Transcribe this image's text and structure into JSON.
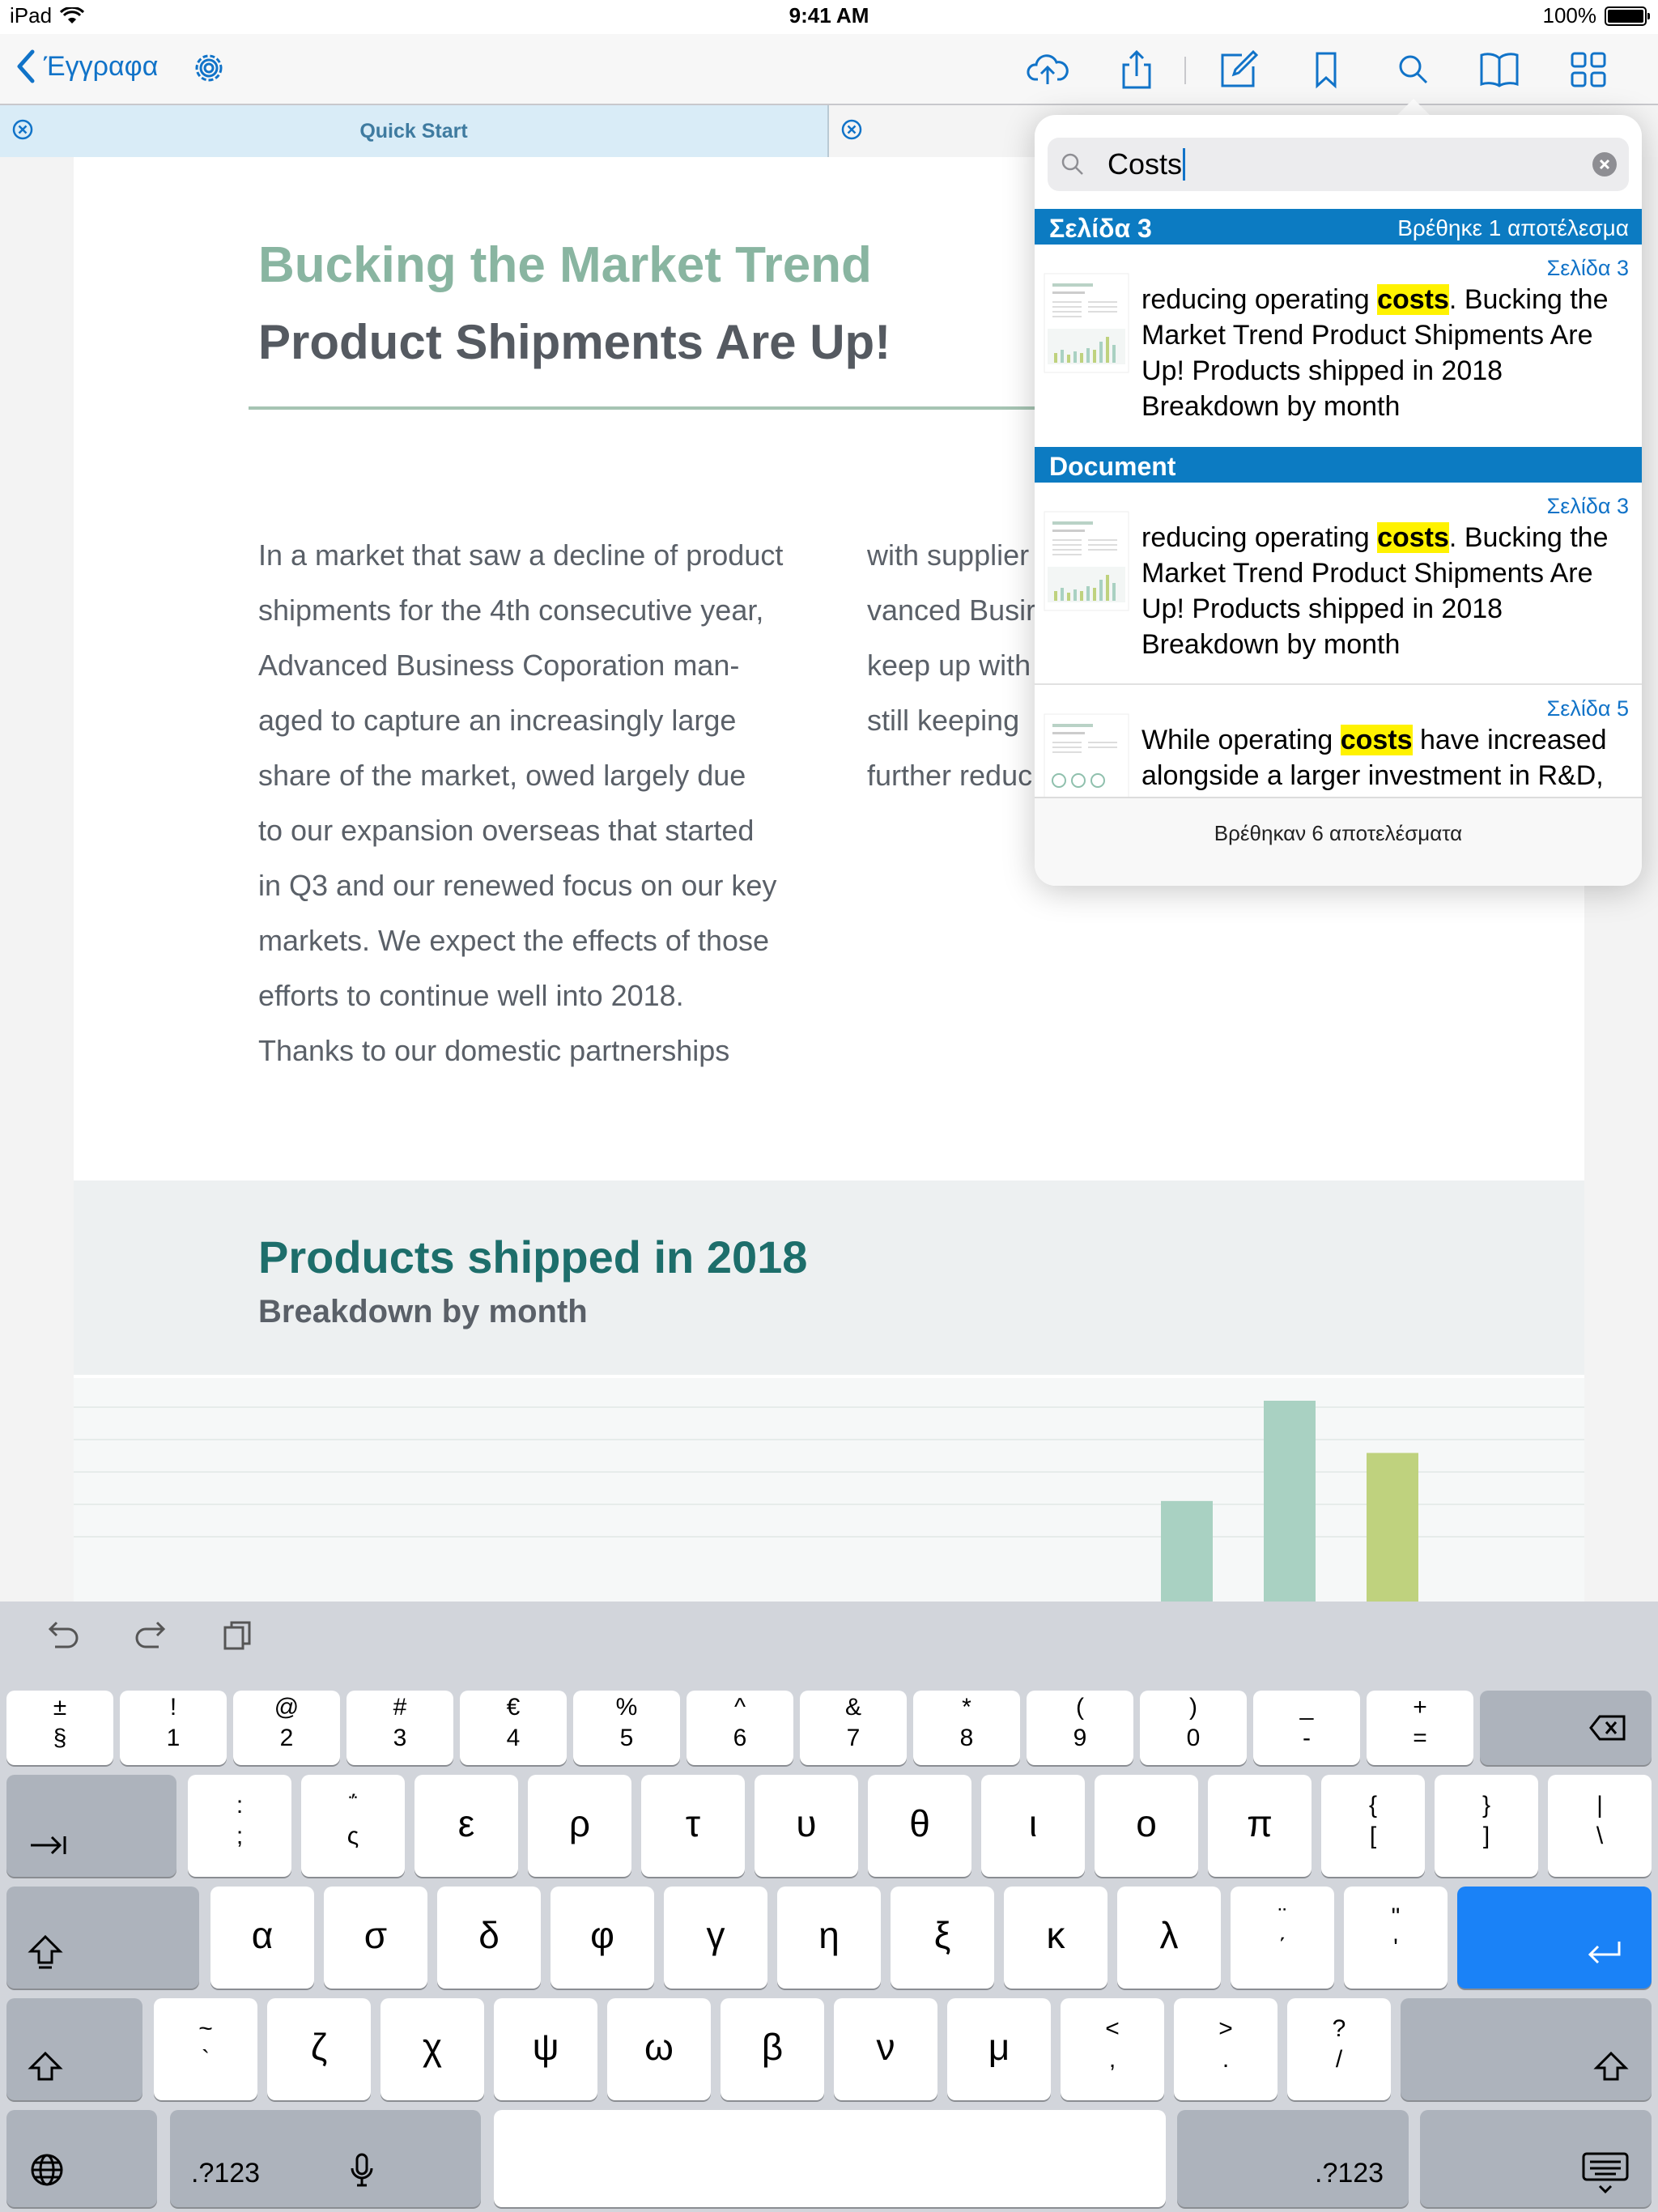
{
  "status_bar": {
    "device": "iPad",
    "time": "9:41 AM",
    "battery": "100%"
  },
  "nav": {
    "back_label": "Έγγραφα"
  },
  "tabs": [
    {
      "label": "Quick Start"
    }
  ],
  "document": {
    "title": "Bucking the Market Trend",
    "subtitle": "Product Shipments Are Up!",
    "col1_lines": [
      "In a market that saw a decline of product",
      "shipments for the 4th consecutive year,",
      "Advanced Business Coporation man-",
      "aged to capture an increasingly large",
      "share of the market, owed largely due",
      "to our expansion overseas that started",
      "in Q3 and our renewed focus on our key",
      "markets. We expect the effects of those",
      "efforts to continue well into 2018.",
      "Thanks to our domestic partnerships"
    ],
    "col2_lines": [
      "with supplier",
      "vanced Busir",
      "keep up with",
      "still keeping",
      "further reduc"
    ],
    "chart_title": "Products shipped in 2018",
    "chart_subtitle": "Breakdown by month"
  },
  "chart_data": {
    "type": "bar",
    "title": "Products shipped in 2018",
    "subtitle": "Breakdown by month",
    "note": "chart partially hidden by keyboard; only top portions of four bars visible",
    "visible_bars": [
      {
        "value": 0.03,
        "color": "#bfd27e"
      },
      {
        "value": 0.52,
        "color": "#a9d1c2"
      },
      {
        "value": 1.0,
        "color": "#a9d1c2"
      },
      {
        "value": 0.75,
        "color": "#bfd27e"
      }
    ]
  },
  "search": {
    "query": "Costs",
    "section_page": {
      "label": "Σελίδα 3",
      "count": "Βρέθηκε 1 αποτέλεσμα"
    },
    "section_document": {
      "label": "Document"
    },
    "results": [
      {
        "page": "Σελίδα 3",
        "before": "reducing operating ",
        "match": "costs",
        "after": ". Bucking the Market Trend Product Shipments Are Up! Products shipped in 2018 Breakdown by month"
      },
      {
        "page": "Σελίδα 3",
        "before": "reducing operating ",
        "match": "costs",
        "after": ". Bucking the Market Trend Product Shipments Are Up! Products shipped in 2018 Breakdown by month"
      },
      {
        "page": "Σελίδα 5",
        "before": "While operating ",
        "match": "costs",
        "after": " have increased alongside a larger investment in R&D,"
      }
    ],
    "footer": "Βρέθηκαν 6 αποτελέσματα"
  },
  "keyboard": {
    "row1": [
      {
        "top": "±",
        "bot": "§"
      },
      {
        "top": "!",
        "bot": "1"
      },
      {
        "top": "@",
        "bot": "2"
      },
      {
        "top": "#",
        "bot": "3"
      },
      {
        "top": "€",
        "bot": "4"
      },
      {
        "top": "%",
        "bot": "5"
      },
      {
        "top": "^",
        "bot": "6"
      },
      {
        "top": "&",
        "bot": "7"
      },
      {
        "top": "*",
        "bot": "8"
      },
      {
        "top": "(",
        "bot": "9"
      },
      {
        "top": ")",
        "bot": "0"
      },
      {
        "top": "_",
        "bot": "-"
      },
      {
        "top": "+",
        "bot": "="
      }
    ],
    "row2": [
      {
        "top": ":",
        "bot": ";"
      },
      {
        "top": "΅",
        "bot": "ς"
      },
      {
        "main": "ε"
      },
      {
        "main": "ρ"
      },
      {
        "main": "τ"
      },
      {
        "main": "υ"
      },
      {
        "main": "θ"
      },
      {
        "main": "ι"
      },
      {
        "main": "ο"
      },
      {
        "main": "π"
      },
      {
        "top": "{",
        "bot": "["
      },
      {
        "top": "}",
        "bot": "]"
      },
      {
        "top": "|",
        "bot": "\\"
      }
    ],
    "row3": [
      {
        "main": "α"
      },
      {
        "main": "σ"
      },
      {
        "main": "δ"
      },
      {
        "main": "φ"
      },
      {
        "main": "γ"
      },
      {
        "main": "η"
      },
      {
        "main": "ξ"
      },
      {
        "main": "κ"
      },
      {
        "main": "λ"
      },
      {
        "top": "¨",
        "bot": "΄"
      },
      {
        "top": "\"",
        "bot": "'"
      }
    ],
    "row4": [
      {
        "top": "~",
        "bot": "`"
      },
      {
        "main": "ζ"
      },
      {
        "main": "χ"
      },
      {
        "main": "ψ"
      },
      {
        "main": "ω"
      },
      {
        "main": "β"
      },
      {
        "main": "ν"
      },
      {
        "main": "μ"
      },
      {
        "top": "<",
        "bot": ","
      },
      {
        "top": ">",
        "bot": "."
      },
      {
        "top": "?",
        "bot": "/"
      }
    ],
    "numbers_label": ".?123"
  }
}
